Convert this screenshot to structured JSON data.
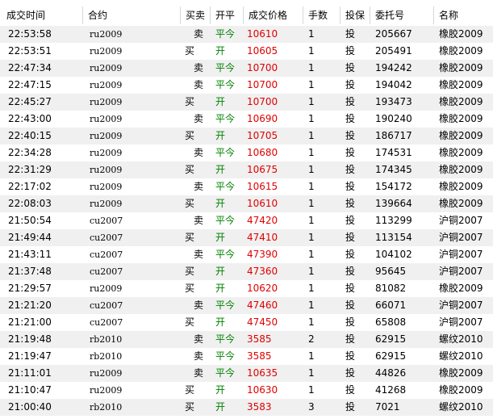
{
  "header": {
    "time": "成交时间",
    "code": "合约",
    "side": "买卖",
    "open_close": "开平",
    "price": "成交价格",
    "qty": "手数",
    "hedge": "投保",
    "order_no": "委托号",
    "name": "名称"
  },
  "rows": [
    {
      "time": "22:53:58",
      "code": "ru2009",
      "side": "卖",
      "side_type": "sell",
      "oc": "平今",
      "price": "10610",
      "qty": "1",
      "hedge": "投",
      "order": "205667",
      "name": "橡胶2009"
    },
    {
      "time": "22:53:51",
      "code": "ru2009",
      "side": "买",
      "side_type": "buy",
      "oc": "开",
      "price": "10605",
      "qty": "1",
      "hedge": "投",
      "order": "205491",
      "name": "橡胶2009"
    },
    {
      "time": "22:47:34",
      "code": "ru2009",
      "side": "卖",
      "side_type": "sell",
      "oc": "平今",
      "price": "10700",
      "qty": "1",
      "hedge": "投",
      "order": "194242",
      "name": "橡胶2009"
    },
    {
      "time": "22:47:15",
      "code": "ru2009",
      "side": "卖",
      "side_type": "sell",
      "oc": "平今",
      "price": "10700",
      "qty": "1",
      "hedge": "投",
      "order": "194042",
      "name": "橡胶2009"
    },
    {
      "time": "22:45:27",
      "code": "ru2009",
      "side": "买",
      "side_type": "buy",
      "oc": "开",
      "price": "10700",
      "qty": "1",
      "hedge": "投",
      "order": "193473",
      "name": "橡胶2009"
    },
    {
      "time": "22:43:00",
      "code": "ru2009",
      "side": "卖",
      "side_type": "sell",
      "oc": "平今",
      "price": "10690",
      "qty": "1",
      "hedge": "投",
      "order": "190240",
      "name": "橡胶2009"
    },
    {
      "time": "22:40:15",
      "code": "ru2009",
      "side": "买",
      "side_type": "buy",
      "oc": "开",
      "price": "10705",
      "qty": "1",
      "hedge": "投",
      "order": "186717",
      "name": "橡胶2009"
    },
    {
      "time": "22:34:28",
      "code": "ru2009",
      "side": "卖",
      "side_type": "sell",
      "oc": "平今",
      "price": "10680",
      "qty": "1",
      "hedge": "投",
      "order": "174531",
      "name": "橡胶2009"
    },
    {
      "time": "22:31:29",
      "code": "ru2009",
      "side": "买",
      "side_type": "buy",
      "oc": "开",
      "price": "10675",
      "qty": "1",
      "hedge": "投",
      "order": "174345",
      "name": "橡胶2009"
    },
    {
      "time": "22:17:02",
      "code": "ru2009",
      "side": "卖",
      "side_type": "sell",
      "oc": "平今",
      "price": "10615",
      "qty": "1",
      "hedge": "投",
      "order": "154172",
      "name": "橡胶2009"
    },
    {
      "time": "22:08:03",
      "code": "ru2009",
      "side": "买",
      "side_type": "buy",
      "oc": "开",
      "price": "10610",
      "qty": "1",
      "hedge": "投",
      "order": "139664",
      "name": "橡胶2009"
    },
    {
      "time": "21:50:54",
      "code": "cu2007",
      "side": "卖",
      "side_type": "sell",
      "oc": "平今",
      "price": "47420",
      "qty": "1",
      "hedge": "投",
      "order": "113299",
      "name": "沪铜2007"
    },
    {
      "time": "21:49:44",
      "code": "cu2007",
      "side": "买",
      "side_type": "buy",
      "oc": "开",
      "price": "47410",
      "qty": "1",
      "hedge": "投",
      "order": "113154",
      "name": "沪铜2007"
    },
    {
      "time": "21:43:11",
      "code": "cu2007",
      "side": "卖",
      "side_type": "sell",
      "oc": "平今",
      "price": "47390",
      "qty": "1",
      "hedge": "投",
      "order": "104102",
      "name": "沪铜2007"
    },
    {
      "time": "21:37:48",
      "code": "cu2007",
      "side": "买",
      "side_type": "buy",
      "oc": "开",
      "price": "47360",
      "qty": "1",
      "hedge": "投",
      "order": "95645",
      "name": "沪铜2007"
    },
    {
      "time": "21:29:57",
      "code": "ru2009",
      "side": "买",
      "side_type": "buy",
      "oc": "开",
      "price": "10620",
      "qty": "1",
      "hedge": "投",
      "order": "81082",
      "name": "橡胶2009"
    },
    {
      "time": "21:21:20",
      "code": "cu2007",
      "side": "卖",
      "side_type": "sell",
      "oc": "平今",
      "price": "47460",
      "qty": "1",
      "hedge": "投",
      "order": "66071",
      "name": "沪铜2007"
    },
    {
      "time": "21:21:00",
      "code": "cu2007",
      "side": "买",
      "side_type": "buy",
      "oc": "开",
      "price": "47450",
      "qty": "1",
      "hedge": "投",
      "order": "65808",
      "name": "沪铜2007"
    },
    {
      "time": "21:19:48",
      "code": "rb2010",
      "side": "卖",
      "side_type": "sell",
      "oc": "平今",
      "price": "3585",
      "qty": "2",
      "hedge": "投",
      "order": "62915",
      "name": "螺纹2010"
    },
    {
      "time": "21:19:47",
      "code": "rb2010",
      "side": "卖",
      "side_type": "sell",
      "oc": "平今",
      "price": "3585",
      "qty": "1",
      "hedge": "投",
      "order": "62915",
      "name": "螺纹2010"
    },
    {
      "time": "21:11:01",
      "code": "ru2009",
      "side": "卖",
      "side_type": "sell",
      "oc": "平今",
      "price": "10635",
      "qty": "1",
      "hedge": "投",
      "order": "44826",
      "name": "橡胶2009"
    },
    {
      "time": "21:10:47",
      "code": "ru2009",
      "side": "买",
      "side_type": "buy",
      "oc": "开",
      "price": "10630",
      "qty": "1",
      "hedge": "投",
      "order": "41268",
      "name": "橡胶2009"
    },
    {
      "time": "21:00:40",
      "code": "rb2010",
      "side": "买",
      "side_type": "buy",
      "oc": "开",
      "price": "3583",
      "qty": "3",
      "hedge": "投",
      "order": "7021",
      "name": "螺纹2010"
    }
  ]
}
